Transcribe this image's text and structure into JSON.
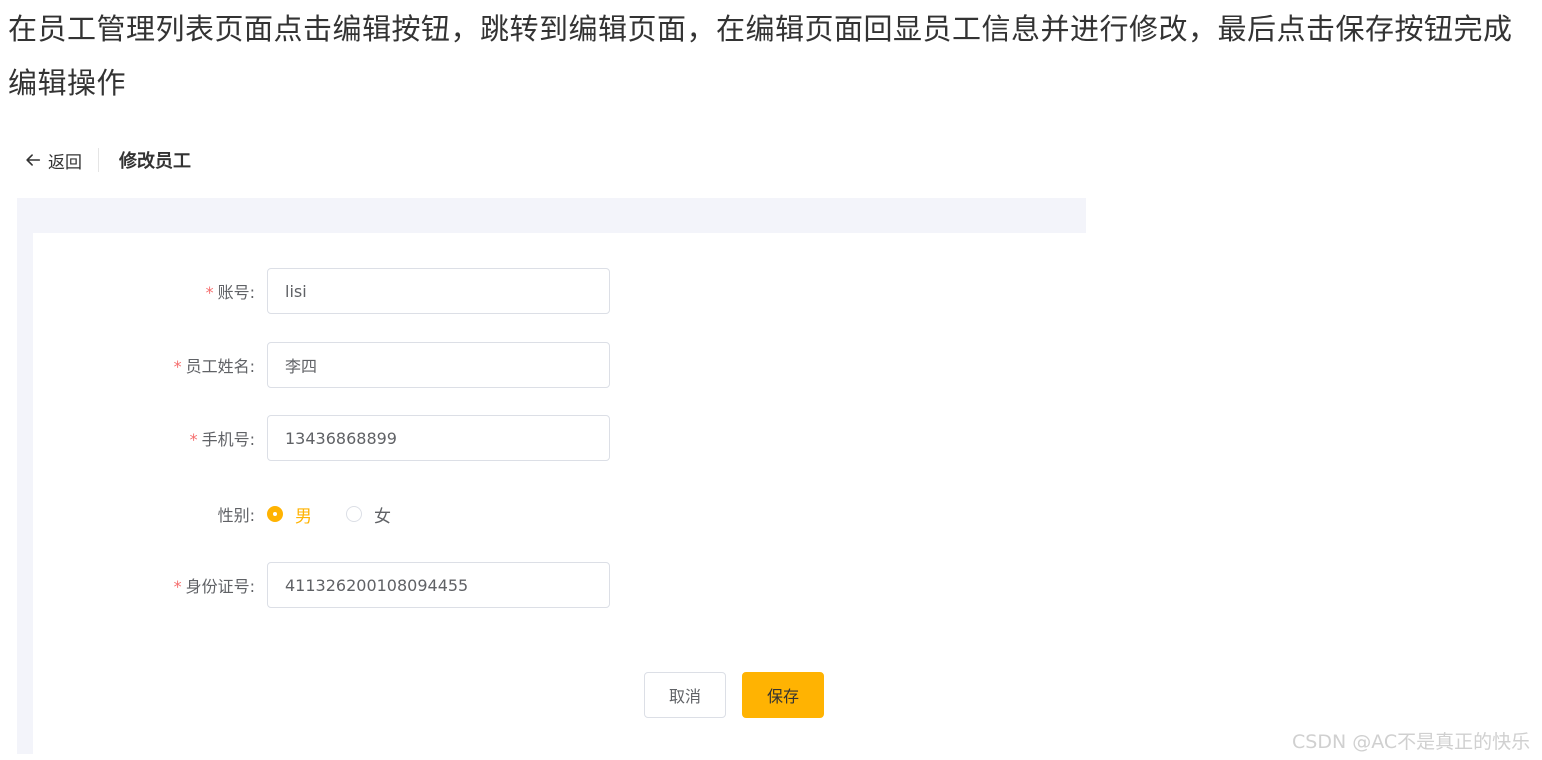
{
  "instruction": "在员工管理列表页面点击编辑按钮，跳转到编辑页面，在编辑页面回显员工信息并进行修改，最后点击保存按钮完成编辑操作",
  "header": {
    "back_label": "返回",
    "title": "修改员工"
  },
  "form": {
    "account": {
      "label": "账号:",
      "value": "lisi",
      "required": true
    },
    "name": {
      "label": "员工姓名:",
      "value": "李四",
      "required": true
    },
    "phone": {
      "label": "手机号:",
      "value": "13436868899",
      "required": true
    },
    "gender": {
      "label": "性别:",
      "options": [
        "男",
        "女"
      ],
      "selected": "男"
    },
    "id_number": {
      "label": "身份证号:",
      "value": "411326200108094455",
      "required": true
    },
    "required_mark": "*"
  },
  "buttons": {
    "cancel_label": "取消",
    "save_label": "保存"
  },
  "watermark": "CSDN @AC不是真正的快乐",
  "colors": {
    "accent": "#ffb302",
    "required": "#f56c6c",
    "panel_bg": "#f3f4fa"
  }
}
